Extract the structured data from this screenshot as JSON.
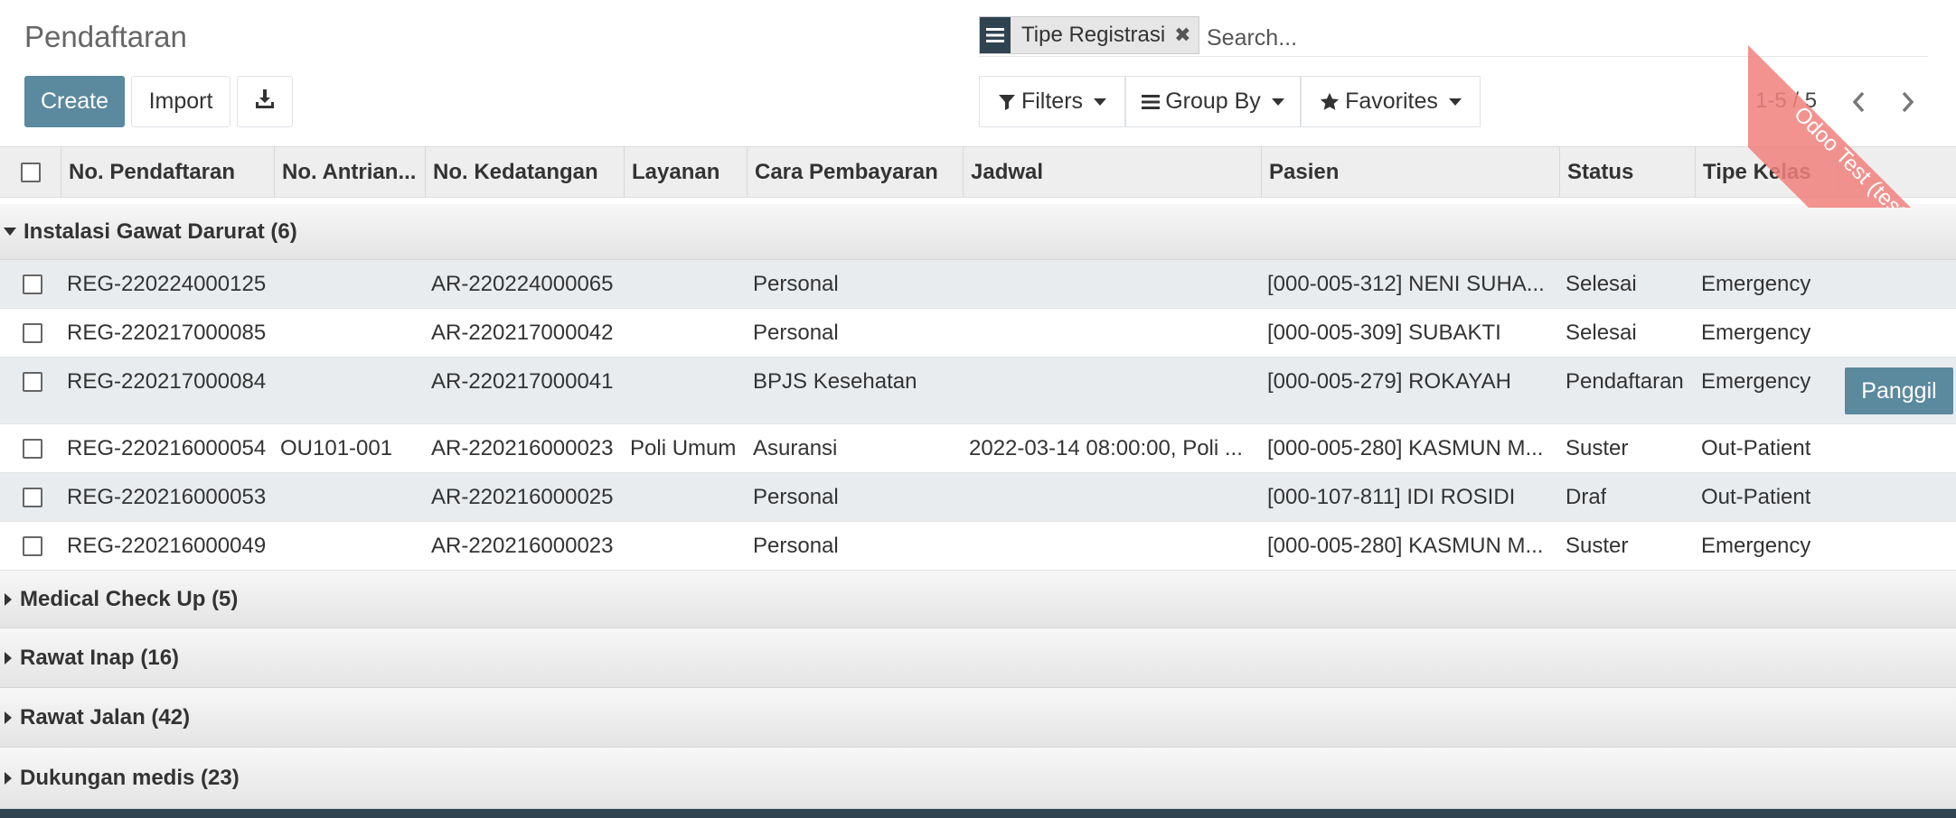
{
  "page": {
    "title": "Pendaftaran"
  },
  "ribbon": {
    "text": "Odoo Test (tester)",
    "color": "#f2817d"
  },
  "toolbar": {
    "create_label": "Create",
    "import_label": "Import",
    "download_icon": "download-icon"
  },
  "search": {
    "facet_icon": "list-icon",
    "facet_value": "Tipe Registrasi",
    "placeholder": "Search..."
  },
  "search_options": {
    "filters_label": "Filters",
    "groupby_label": "Group By",
    "favorites_label": "Favorites"
  },
  "pager": {
    "value": "1-5 / 5"
  },
  "colors": {
    "accent": "#5b899e",
    "dark": "#2f4350"
  },
  "table": {
    "headers": [
      "No. Pendaftaran",
      "No. Antrian...",
      "No. Kedatangan",
      "Layanan",
      "Cara Pembayaran",
      "Jadwal",
      "Pasien",
      "Status",
      "Tipe Kelas"
    ],
    "open_group": "Instalasi Gawat Darurat (6)",
    "rows": [
      {
        "no": "REG-220224000125",
        "antrian": "",
        "kedatangan": "AR-220224000065",
        "layanan": "",
        "bayar": "Personal",
        "jadwal": "",
        "pasien": "[000-005-312] NENI SUHA...",
        "status": "Selesai",
        "kelas": "Emergency"
      },
      {
        "no": "REG-220217000085",
        "antrian": "",
        "kedatangan": "AR-220217000042",
        "layanan": "",
        "bayar": "Personal",
        "jadwal": "",
        "pasien": "[000-005-309] SUBAKTI",
        "status": "Selesai",
        "kelas": "Emergency"
      },
      {
        "no": "REG-220217000084",
        "antrian": "",
        "kedatangan": "AR-220217000041",
        "layanan": "",
        "bayar": "BPJS Kesehatan",
        "jadwal": "",
        "pasien": "[000-005-279] ROKAYAH",
        "status": "Pendaftaran",
        "kelas": "Emergency",
        "action": "Panggil"
      },
      {
        "no": "REG-220216000054",
        "antrian": "OU101-001",
        "kedatangan": "AR-220216000023",
        "layanan": "Poli Umum",
        "bayar": "Asuransi",
        "jadwal": "2022-03-14 08:00:00, Poli ...",
        "pasien": "[000-005-280] KASMUN M...",
        "status": "Suster",
        "kelas": "Out-Patient"
      },
      {
        "no": "REG-220216000053",
        "antrian": "",
        "kedatangan": "AR-220216000025",
        "layanan": "",
        "bayar": "Personal",
        "jadwal": "",
        "pasien": "[000-107-811] IDI ROSIDI",
        "status": "Draf",
        "kelas": "Out-Patient"
      },
      {
        "no": "REG-220216000049",
        "antrian": "",
        "kedatangan": "AR-220216000023",
        "layanan": "",
        "bayar": "Personal",
        "jadwal": "",
        "pasien": "[000-005-280] KASMUN M...",
        "status": "Suster",
        "kelas": "Emergency"
      }
    ],
    "collapsed_groups": [
      "Medical Check Up (5)",
      "Rawat Inap (16)",
      "Rawat Jalan (42)",
      "Dukungan medis (23)"
    ]
  }
}
